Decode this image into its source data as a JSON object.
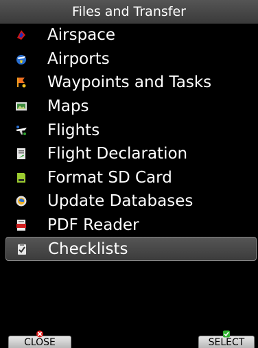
{
  "title": "Files and Transfer",
  "menu": {
    "items": [
      {
        "label": "Airspace",
        "icon": "airspace-icon"
      },
      {
        "label": "Airports",
        "icon": "airports-icon"
      },
      {
        "label": "Waypoints and Tasks",
        "icon": "waypoints-icon"
      },
      {
        "label": "Maps",
        "icon": "maps-icon"
      },
      {
        "label": "Flights",
        "icon": "flights-icon"
      },
      {
        "label": "Flight Declaration",
        "icon": "flight-declaration-icon"
      },
      {
        "label": "Format SD Card",
        "icon": "sd-card-icon"
      },
      {
        "label": "Update Databases",
        "icon": "update-databases-icon"
      },
      {
        "label": "PDF Reader",
        "icon": "pdf-icon"
      },
      {
        "label": "Checklists",
        "icon": "checklist-icon"
      }
    ],
    "selected_index": 9
  },
  "softkeys": {
    "close_label": "CLOSE",
    "select_label": "SELECT"
  },
  "colors": {
    "background": "#000000",
    "close_indicator": "#e02020",
    "select_indicator": "#30b030"
  }
}
